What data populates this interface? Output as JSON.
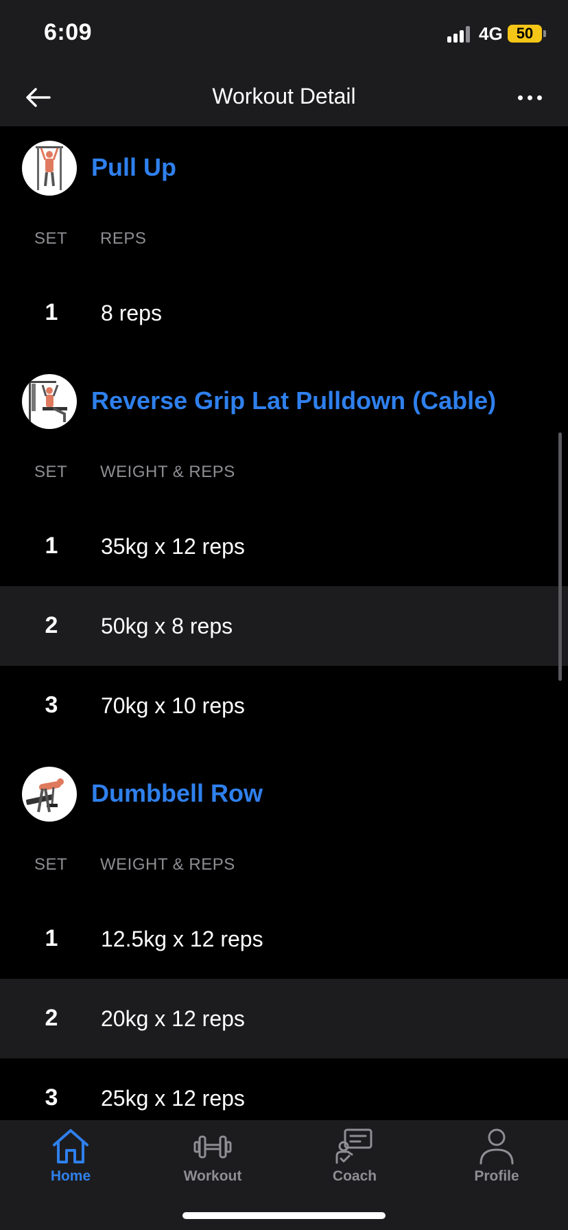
{
  "status_bar": {
    "time": "6:09",
    "network": "4G",
    "battery": "50"
  },
  "nav": {
    "title": "Workout Detail"
  },
  "exercises": [
    {
      "name": "Pull Up",
      "col_set": "SET",
      "col_value": "REPS",
      "sets": [
        {
          "num": "1",
          "value": "8 reps"
        }
      ]
    },
    {
      "name": "Reverse Grip Lat Pulldown (Cable)",
      "col_set": "SET",
      "col_value": "WEIGHT & REPS",
      "sets": [
        {
          "num": "1",
          "value": "35kg x 12 reps"
        },
        {
          "num": "2",
          "value": "50kg x 8 reps"
        },
        {
          "num": "3",
          "value": "70kg x 10 reps"
        }
      ]
    },
    {
      "name": "Dumbbell Row",
      "col_set": "SET",
      "col_value": "WEIGHT & REPS",
      "sets": [
        {
          "num": "1",
          "value": "12.5kg x 12 reps"
        },
        {
          "num": "2",
          "value": "20kg x 12 reps"
        },
        {
          "num": "3",
          "value": "25kg x 12 reps"
        }
      ]
    }
  ],
  "tabs": [
    {
      "label": "Home",
      "icon": "home-icon",
      "active": true
    },
    {
      "label": "Workout",
      "icon": "dumbbell-icon",
      "active": false
    },
    {
      "label": "Coach",
      "icon": "coach-icon",
      "active": false
    },
    {
      "label": "Profile",
      "icon": "person-icon",
      "active": false
    }
  ],
  "colors": {
    "accent": "#2f80ed",
    "background": "#000000",
    "surface": "#1c1c1e",
    "muted": "#8e8e93",
    "battery": "#f5c518"
  }
}
